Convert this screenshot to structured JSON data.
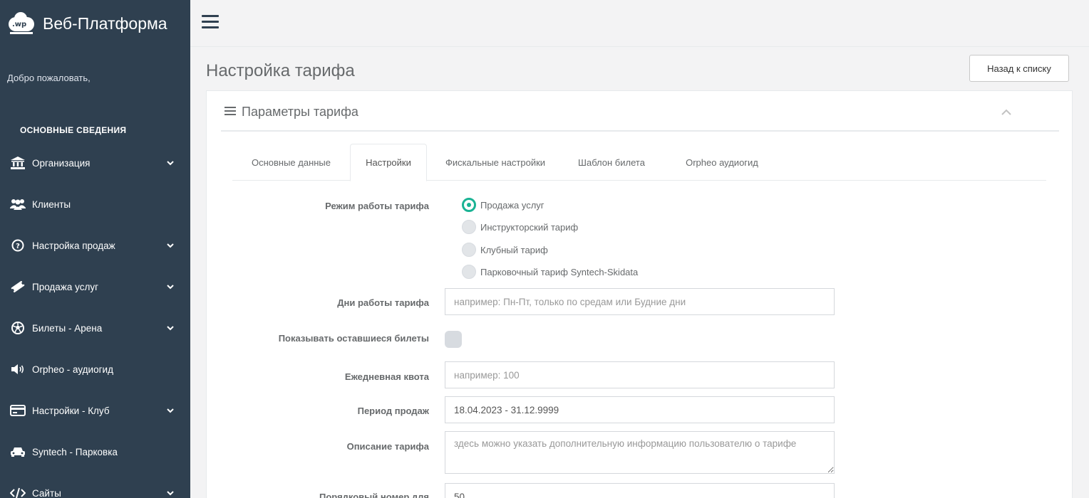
{
  "brand": {
    "logo_text": ".wp",
    "title": "Веб-Платформа"
  },
  "sidebar": {
    "welcome": "Добро пожаловать,",
    "section_label": "ОСНОВНЫЕ СВЕДЕНИЯ",
    "items": [
      {
        "label": "Организация",
        "icon": "bank-icon",
        "has_submenu": true
      },
      {
        "label": "Клиенты",
        "icon": "users-icon",
        "has_submenu": false
      },
      {
        "label": "Настройка продаж",
        "icon": "question-circle-icon",
        "has_submenu": true
      },
      {
        "label": "Продажа услуг",
        "icon": "ticket-icon",
        "has_submenu": true
      },
      {
        "label": "Билеты - Арена",
        "icon": "soccer-ball-icon",
        "has_submenu": true
      },
      {
        "label": "Orpheo - аудиогид",
        "icon": "volume-icon",
        "has_submenu": false
      },
      {
        "label": "Настройки - Клуб",
        "icon": "credit-card-icon",
        "has_submenu": true
      },
      {
        "label": "Syntech - Парковка",
        "icon": "car-icon",
        "has_submenu": false
      },
      {
        "label": "Сайты",
        "icon": "code-icon",
        "has_submenu": true
      }
    ]
  },
  "page": {
    "title": "Настройка тарифа",
    "back_button": "Назад к списку"
  },
  "panel": {
    "title": "Параметры тарифа",
    "tabs": [
      {
        "label": "Основные данные",
        "active": false
      },
      {
        "label": "Настройки",
        "active": true
      },
      {
        "label": "Фискальные настройки",
        "active": false
      },
      {
        "label": "Шаблон билета",
        "active": false
      },
      {
        "label": "Orpheo аудиогид",
        "active": false
      }
    ]
  },
  "form": {
    "mode": {
      "label": "Режим работы тарифа",
      "options": [
        {
          "label": "Продажа услуг",
          "checked": true
        },
        {
          "label": "Инструкторский тариф",
          "checked": false
        },
        {
          "label": "Клубный тариф",
          "checked": false
        },
        {
          "label": "Парковочный тариф Syntech-Skidata",
          "checked": false
        }
      ]
    },
    "days": {
      "label": "Дни работы тарифа",
      "value": "",
      "placeholder": "например: Пн-Пт, только по средам или Будние дни"
    },
    "show_remaining": {
      "label": "Показывать оставшиеся билеты",
      "checked": false
    },
    "daily_quota": {
      "label": "Ежедневная квота",
      "value": "",
      "placeholder": "например: 100"
    },
    "sales_period": {
      "label": "Период продаж",
      "value": "18.04.2023 - 31.12.9999",
      "placeholder": ""
    },
    "description": {
      "label": "Описание тарифа",
      "value": "",
      "placeholder": "здесь можно указать дополнительную информацию пользователю о тарифе"
    },
    "order_number": {
      "label": "Порядковый номер для",
      "value": "50"
    }
  },
  "colors": {
    "sidebar_bg": "#2f4050",
    "accent": "#1ab394",
    "page_bg": "#f3f3f4"
  }
}
